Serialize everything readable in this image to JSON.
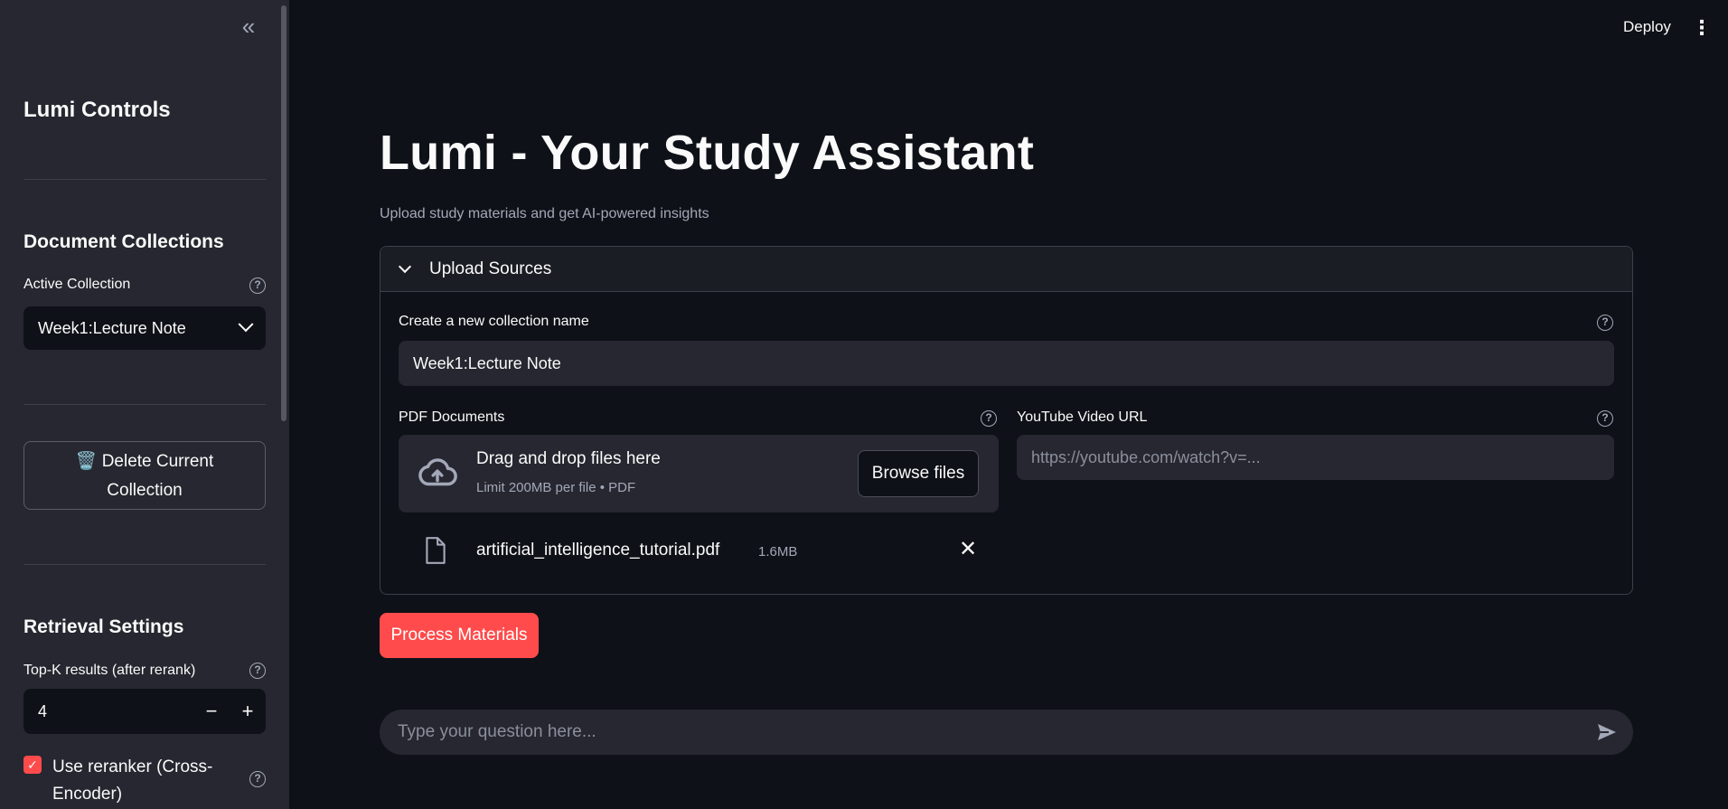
{
  "sidebar": {
    "collapse_icon": "«",
    "title": "Lumi Controls",
    "collections_heading": "Document Collections",
    "active_collection_label": "Active Collection",
    "active_collection_value": "Week1:Lecture Note",
    "delete_icon": "🗑️",
    "delete_label_line1": "Delete Current",
    "delete_label_line2": "Collection",
    "retrieval_heading": "Retrieval Settings",
    "topk_label": "Top-K results (after rerank)",
    "topk_value": "4",
    "minus": "−",
    "plus": "+",
    "reranker_label": "Use reranker (Cross-Encoder)",
    "reranker_checked": true,
    "help": "?"
  },
  "header": {
    "deploy_label": "Deploy",
    "menu_icon": "⋮"
  },
  "main": {
    "title": "Lumi - Your Study Assistant",
    "subtitle": "Upload study materials and get AI-powered insights",
    "expander_label": "Upload Sources",
    "collection_name_label": "Create a new collection name",
    "collection_name_value": "Week1:Lecture Note",
    "pdf_label": "PDF Documents",
    "dropzone_title": "Drag and drop files here",
    "dropzone_sub": "Limit 200MB per file • PDF",
    "browse_label": "Browse files",
    "file_name": "artificial_intelligence_tutorial.pdf",
    "file_size": "1.6MB",
    "youtube_label": "YouTube Video URL",
    "youtube_placeholder": "https://youtube.com/watch?v=...",
    "process_label": "Process Materials",
    "chat_placeholder": "Type your question here..."
  },
  "colors": {
    "accent": "#ff4b4b",
    "background": "#0e1117",
    "sidebar": "#262730"
  }
}
